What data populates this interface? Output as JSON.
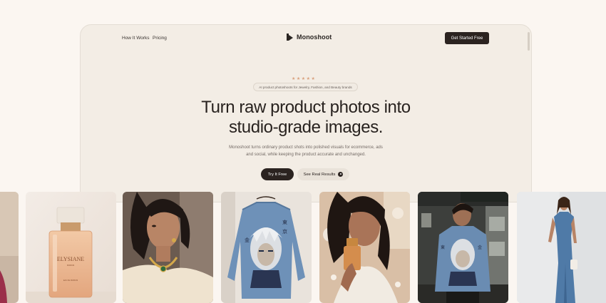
{
  "nav": {
    "how_it_works": "How It Works",
    "pricing": "Pricing",
    "brand": "Monoshoot",
    "cta": "Get Started Free"
  },
  "hero": {
    "stars": "★★★★★",
    "tagline": "AI product photoshoots for Jewelry, Fashion, and Beauty brands",
    "headline_line1": "Turn raw product photos into",
    "headline_line2": "studio-grade images.",
    "sub_line1": "Monoshoot turns ordinary product shots into polished visuals for ecommerce, ads",
    "sub_line2": "and social, while keeping the product accurate and unchanged.",
    "primary_button": "Try It Free",
    "secondary_button": "See Real Results"
  },
  "gallery": {
    "perfume_brand": "ELYSIANE",
    "perfume_sub": "PARFUM",
    "perfume_note": "EAU DE PARFUM"
  },
  "colors": {
    "page_bg": "#fbf6f1",
    "frame_bg": "#f3ede5",
    "primary": "#2b2320",
    "star": "#d9a07d"
  }
}
